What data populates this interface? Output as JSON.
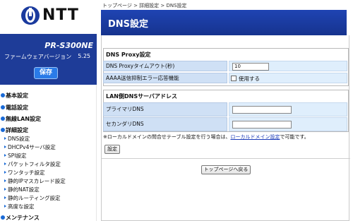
{
  "brand": {
    "logo_text": "NTT"
  },
  "device": {
    "model": "PR-S300NE",
    "firmware_label": "ファームウェアバージョン",
    "firmware_version": "5.25",
    "save_label": "保存"
  },
  "sidebar": {
    "items": [
      {
        "label": "基本設定"
      },
      {
        "label": "電話設定"
      },
      {
        "label": "無線LAN設定"
      },
      {
        "label": "詳細設定"
      },
      {
        "label": "メンテナンス"
      }
    ],
    "subitems": [
      "DNS設定",
      "DHCPv4サーバ設定",
      "SPI設定",
      "パケットフィルタ設定",
      "ワンタッチ設定",
      "静的IPマスカレード設定",
      "静的NAT設定",
      "静的ルーティング設定",
      "高度な設定"
    ]
  },
  "breadcrumb": "トップページ > 詳細設定 > DNS設定",
  "page_title": "DNS設定",
  "dns_proxy": {
    "section_title": "DNS Proxy設定",
    "timeout_label": "DNS Proxyタイムアウト(秒)",
    "timeout_value": "10",
    "aaaa_label": "AAAA送信抑制エラー応答機能",
    "aaaa_option": "使用する"
  },
  "lan_dns": {
    "section_title": "LAN側DNSサーバアドレス",
    "primary_label": "プライマリDNS",
    "primary_value": "",
    "secondary_label": "セカンダリDNS",
    "secondary_value": ""
  },
  "note": {
    "prefix": "※ローカルドメインの問合せテーブル設定を行う場合は、",
    "link": "ローカルドメイン設定",
    "suffix": "で可能です。"
  },
  "buttons": {
    "apply": "設定",
    "top": "トップページへ戻る"
  }
}
